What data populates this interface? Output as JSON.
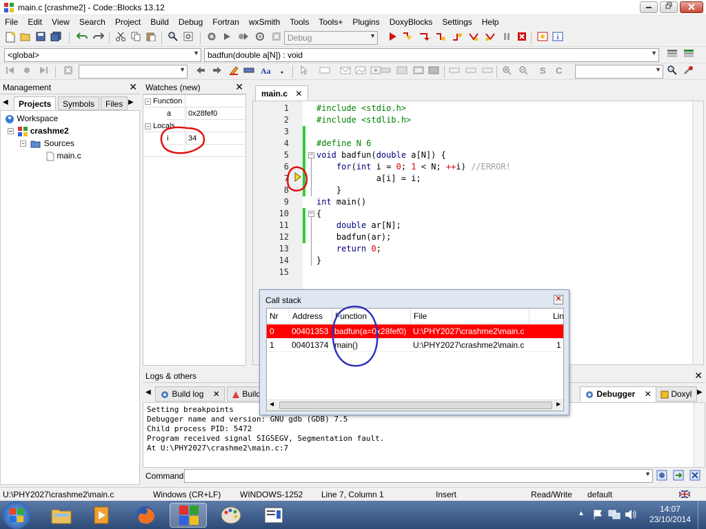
{
  "window": {
    "title": "main.c [crashme2] - Code::Blocks 13.12",
    "minimize": "0",
    "maximize": "1",
    "close": "r"
  },
  "menu": [
    "File",
    "Edit",
    "View",
    "Search",
    "Project",
    "Build",
    "Debug",
    "Fortran",
    "wxSmith",
    "Tools",
    "Tools+",
    "Plugins",
    "DoxyBlocks",
    "Settings",
    "Help"
  ],
  "toolbar": {
    "build_target": "Debug",
    "scope": "<global>",
    "symbol": "badfun(double a[N]) : void"
  },
  "management": {
    "title": "Management",
    "tabs": [
      "Projects",
      "Symbols",
      "Files"
    ],
    "tree": {
      "workspace": "Workspace",
      "project": "crashme2",
      "folder": "Sources",
      "file": "main.c"
    }
  },
  "watches": {
    "title": "Watches (new)",
    "function_label": "Function",
    "locals_label": "Locals",
    "rows": [
      {
        "name": "a",
        "value": "0x28fef0"
      },
      {
        "name": "i",
        "value": "34"
      }
    ]
  },
  "editor": {
    "tab": "main.c",
    "lines": [
      {
        "n": "1",
        "segments": [
          {
            "t": "#include <stdio.h>",
            "c": "pp"
          }
        ]
      },
      {
        "n": "2",
        "segments": [
          {
            "t": "#include <stdlib.h>",
            "c": "pp"
          }
        ]
      },
      {
        "n": "3",
        "segments": []
      },
      {
        "n": "4",
        "segments": [
          {
            "t": "#define N 6",
            "c": "pp"
          }
        ]
      },
      {
        "n": "5",
        "segments": [
          {
            "t": "void",
            "c": "kw"
          },
          {
            "t": " badfun(",
            "c": ""
          },
          {
            "t": "double",
            "c": "kw"
          },
          {
            "t": " a[N]) {",
            "c": ""
          }
        ]
      },
      {
        "n": "6",
        "segments": [
          {
            "t": "    ",
            "c": ""
          },
          {
            "t": "for",
            "c": "kw"
          },
          {
            "t": "(",
            "c": ""
          },
          {
            "t": "int",
            "c": "kw"
          },
          {
            "t": " i = ",
            "c": ""
          },
          {
            "t": "0",
            "c": "num"
          },
          {
            "t": "; ",
            "c": ""
          },
          {
            "t": "1",
            "c": "num"
          },
          {
            "t": " < N; ",
            "c": ""
          },
          {
            "t": "++",
            "c": "op"
          },
          {
            "t": "i) ",
            "c": ""
          },
          {
            "t": "//ERROR!",
            "c": "cmt"
          }
        ]
      },
      {
        "n": "7",
        "segments": [
          {
            "t": "            a[i] = i;",
            "c": ""
          }
        ]
      },
      {
        "n": "8",
        "segments": [
          {
            "t": "    }",
            "c": ""
          }
        ]
      },
      {
        "n": "9",
        "segments": [
          {
            "t": "int",
            "c": "kw"
          },
          {
            "t": " main()",
            "c": ""
          }
        ]
      },
      {
        "n": "10",
        "segments": [
          {
            "t": "{",
            "c": ""
          }
        ]
      },
      {
        "n": "11",
        "segments": [
          {
            "t": "    ",
            "c": ""
          },
          {
            "t": "double",
            "c": "kw"
          },
          {
            "t": " ar[N];",
            "c": ""
          }
        ]
      },
      {
        "n": "12",
        "segments": [
          {
            "t": "    badfun(ar);",
            "c": ""
          }
        ]
      },
      {
        "n": "13",
        "segments": [
          {
            "t": "    ",
            "c": ""
          },
          {
            "t": "return",
            "c": "kw"
          },
          {
            "t": " ",
            "c": ""
          },
          {
            "t": "0",
            "c": "num"
          },
          {
            "t": ";",
            "c": ""
          }
        ]
      },
      {
        "n": "14",
        "segments": [
          {
            "t": "}",
            "c": ""
          }
        ]
      },
      {
        "n": "15",
        "segments": []
      }
    ]
  },
  "callstack": {
    "title": "Call stack",
    "columns": [
      "Nr",
      "Address",
      "Function",
      "File",
      "Lin"
    ],
    "rows": [
      {
        "nr": "0",
        "address": "00401353",
        "function": "badfun(a=0x28fef0)",
        "file": "U:\\PHY2027\\crashme2\\main.c",
        "line": "",
        "selected": true
      },
      {
        "nr": "1",
        "address": "00401374",
        "function": "main()",
        "file": "U:\\PHY2027\\crashme2\\main.c",
        "line": "1",
        "selected": false
      }
    ]
  },
  "logs": {
    "title": "Logs & others",
    "tabs": [
      "Build log",
      "Build",
      "Debugger",
      "Doxyl"
    ],
    "lines": [
      "Setting breakpoints",
      "Debugger name and version: GNU gdb (GDB) 7.5",
      "Child process PID: 5472",
      "Program received signal SIGSEGV, Segmentation fault.",
      "At U:\\PHY2027\\crashme2\\main.c:7"
    ],
    "command_label": "Command:"
  },
  "status": {
    "file": "U:\\PHY2027\\crashme2\\main.c",
    "eol": "Windows (CR+LF)",
    "encoding": "WINDOWS-1252",
    "position": "Line 7, Column 1",
    "mode": "Insert",
    "access": "Read/Write",
    "profile": "default"
  },
  "taskbar": {
    "time": "14:07",
    "date": "23/10/2014"
  },
  "colors": {
    "selection_red": "#ff0000",
    "annotation_red": "#e01010",
    "annotation_blue": "#3030c0",
    "mod_green": "#2ecc40"
  }
}
